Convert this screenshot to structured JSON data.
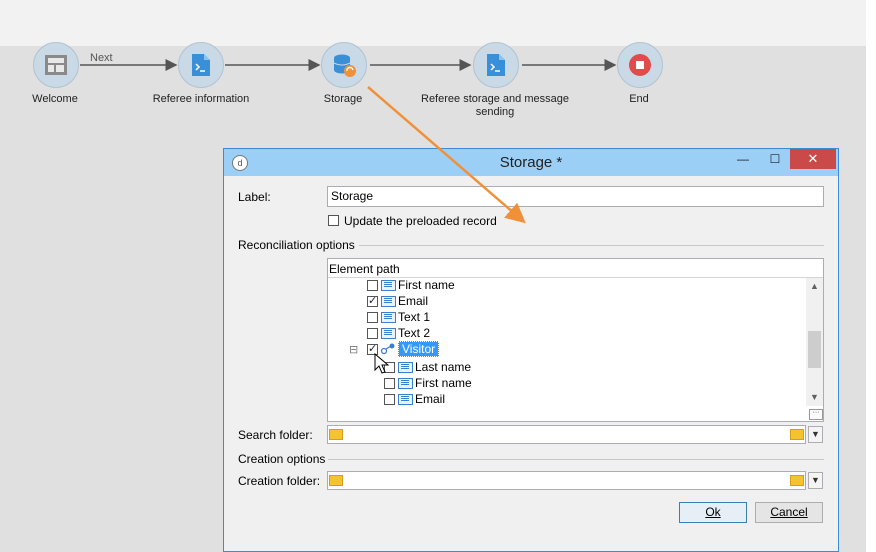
{
  "workflow": {
    "next_label": "Next",
    "nodes": [
      {
        "label": "Welcome",
        "icon": "page-layout-icon"
      },
      {
        "label": "Referee information",
        "icon": "script-page-icon"
      },
      {
        "label": "Storage",
        "icon": "database-sync-icon"
      },
      {
        "label": "Referee storage and message sending",
        "icon": "script-page-icon"
      },
      {
        "label": "End",
        "icon": "stop-icon"
      }
    ],
    "colors": {
      "node_fill": "#c9d9e6",
      "blue_icon": "#3a8fd9",
      "stop_red": "#e04b4b",
      "arrow_orange": "#f0913a"
    }
  },
  "dialog": {
    "title": "Storage *",
    "app_icon_letter": "d",
    "minimize_glyph": "—",
    "maximize_glyph": "☐",
    "close_glyph": "✕",
    "label_caption": "Label:",
    "label_value": "Storage",
    "update_checkbox_label": "Update the preloaded record",
    "update_checked": false,
    "reconciliation_title": "Reconciliation options",
    "tree_header": "Element path",
    "tree_rows": [
      {
        "label": "First name",
        "checked": false
      },
      {
        "label": "Email",
        "checked": true
      },
      {
        "label": "Text 1",
        "checked": false
      },
      {
        "label": "Text 2",
        "checked": false
      },
      {
        "label": "Visitor",
        "checked": true,
        "selected": true,
        "expander": "⊟"
      },
      {
        "label": "Last name",
        "checked": false
      },
      {
        "label": "First name",
        "checked": false
      },
      {
        "label": "Email",
        "checked": false
      }
    ],
    "scroll_up": "▲",
    "scroll_down": "▼",
    "more_button": "···",
    "search_folder_caption": "Search folder:",
    "creation_options_title": "Creation options",
    "creation_folder_caption": "Creation folder:",
    "combo_arrow": "▼",
    "ok_label": "Ok",
    "cancel_label": "Cancel",
    "colors": {
      "titlebar": "#9ccff5",
      "close": "#c94a48",
      "selection": "#3399ff"
    }
  }
}
